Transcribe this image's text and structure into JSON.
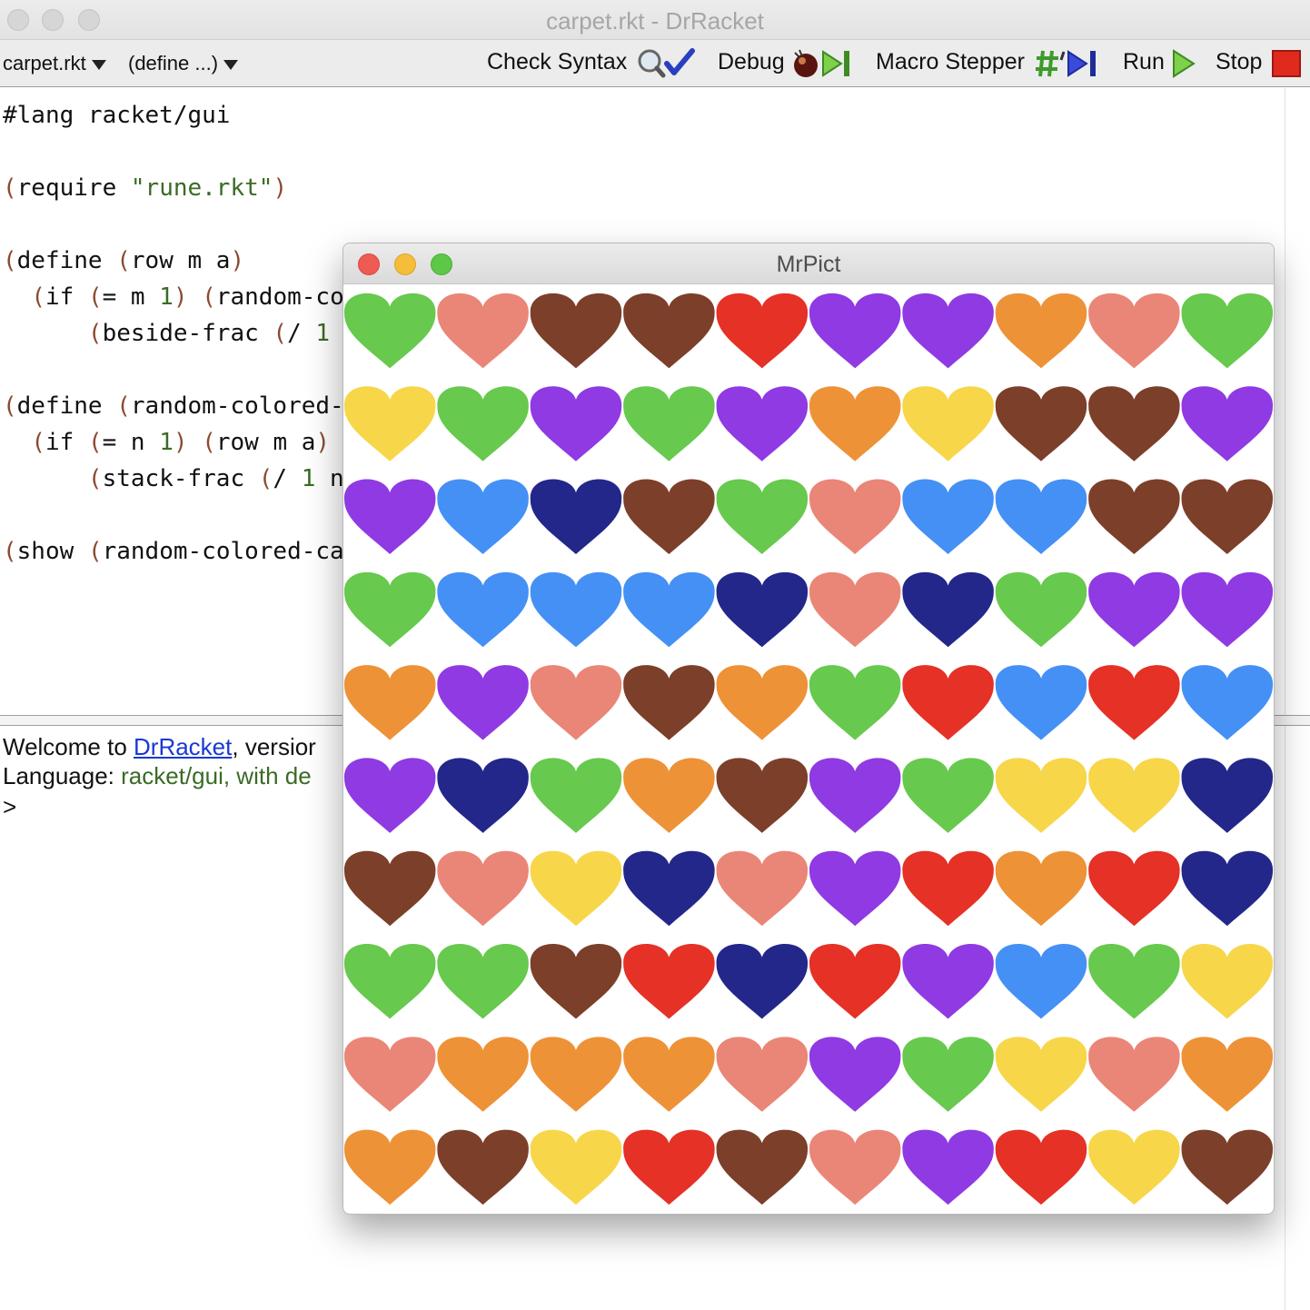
{
  "window": {
    "title": "carpet.rkt - DrRacket"
  },
  "toolbar": {
    "file_menu": "carpet.rkt",
    "define_menu": "(define ...)",
    "check_syntax": "Check Syntax",
    "debug": "Debug",
    "macro_stepper": "Macro Stepper",
    "run": "Run",
    "stop": "Stop"
  },
  "editor": {
    "lines": [
      "#lang racket/gui",
      "",
      "(require \"rune.rkt\")",
      "",
      "(define (row m a)",
      "  (if (= m 1) (random-co",
      "      (beside-frac (/ 1",
      "",
      "(define (random-colored-",
      "  (if (= n 1) (row m a)",
      "      (stack-frac (/ 1 n",
      "",
      "(show (random-colored-ca"
    ]
  },
  "repl": {
    "welcome_prefix": "Welcome to ",
    "welcome_link": "DrRacket",
    "welcome_suffix": ", versior",
    "language_label": "Language: ",
    "language_value": "racket/gui, with de",
    "prompt": ">"
  },
  "mrpict": {
    "title": "MrPict",
    "palette": {
      "G": "#67c94d",
      "S": "#ea8677",
      "B": "#7c3f2a",
      "R": "#e53126",
      "P": "#8f3ae2",
      "O": "#ee9237",
      "Y": "#f7d64a",
      "L": "#4590f5",
      "N": "#23278a"
    },
    "rows": [
      [
        "G",
        "S",
        "B",
        "B",
        "R",
        "P",
        "P",
        "O",
        "S",
        "G"
      ],
      [
        "Y",
        "G",
        "P",
        "G",
        "P",
        "O",
        "Y",
        "B",
        "B",
        "P"
      ],
      [
        "P",
        "L",
        "N",
        "B",
        "G",
        "S",
        "L",
        "L",
        "B",
        "B"
      ],
      [
        "G",
        "L",
        "L",
        "L",
        "N",
        "S",
        "N",
        "G",
        "P",
        "P"
      ],
      [
        "O",
        "P",
        "S",
        "B",
        "O",
        "G",
        "R",
        "L",
        "R",
        "L"
      ],
      [
        "P",
        "N",
        "G",
        "O",
        "B",
        "P",
        "G",
        "Y",
        "Y",
        "N"
      ],
      [
        "B",
        "S",
        "Y",
        "N",
        "S",
        "P",
        "R",
        "O",
        "R",
        "N"
      ],
      [
        "G",
        "G",
        "B",
        "R",
        "N",
        "R",
        "P",
        "L",
        "G",
        "Y"
      ],
      [
        "S",
        "O",
        "O",
        "O",
        "S",
        "P",
        "G",
        "Y",
        "S",
        "O"
      ],
      [
        "O",
        "B",
        "Y",
        "R",
        "B",
        "S",
        "P",
        "R",
        "Y",
        "B"
      ]
    ]
  }
}
